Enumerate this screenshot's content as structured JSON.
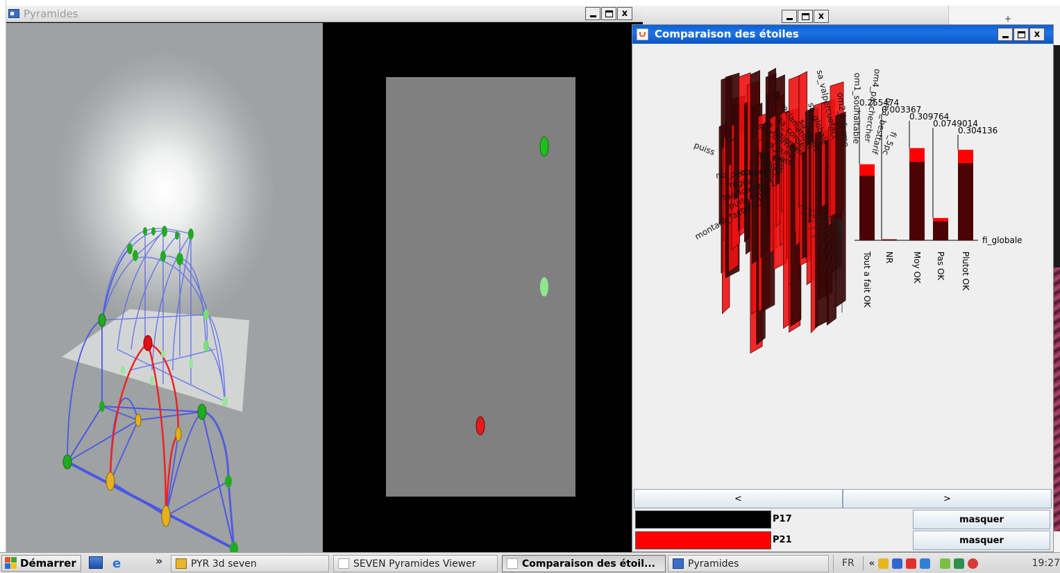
{
  "pyramides_window": {
    "title": "Pyramides",
    "controls": {
      "minimize": "_",
      "maximize": "□",
      "close": "x"
    }
  },
  "background_window": {
    "controls": {
      "minimize": "_",
      "maximize": "□",
      "close": "x"
    }
  },
  "far_right_marks": "+",
  "comparaison_window": {
    "title": "Comparaison des étoiles",
    "controls": {
      "minimize": "_",
      "maximize": "□",
      "close": "x"
    },
    "nav": {
      "prev_label": "<",
      "next_label": ">"
    },
    "legend": [
      {
        "label": "P17",
        "color": "#000000",
        "button": "masquer"
      },
      {
        "label": "P21",
        "color": "#ff0000",
        "button": "masquer"
      }
    ]
  },
  "chart_data": {
    "type": "bar",
    "star_axes": [
      "montant_facture_HT",
      "puissance",
      "tarification",
      "naf_1",
      "region_site",
      "nb_personnes",
      "contactEDF",
      "image",
      "sa_tel",
      "sa_visite",
      "sa_suivi",
      "sa_courrier",
      "sa_paiement",
      "sa_conseil",
      "sa_reclamation",
      "sa_tarifs",
      "sa_globale",
      "sa_valpercuefact",
      "om2_informe",
      "om1_souhaitable",
      "om4_paschercher",
      "om3_besttarif",
      "fi_5pc"
    ],
    "partial_axis_labels": [
      "puiss",
      "ay"
    ],
    "bar_axis_label": "fi_globale",
    "categories": [
      "Tout a fait OK",
      "NR",
      "Moy OK",
      "Pas OK",
      "Plutot OK"
    ],
    "value_labels": [
      "0.255474",
      "0.003367",
      "0.309764",
      "0.0749014",
      "0.304136"
    ],
    "series": [
      {
        "name": "P17",
        "color": "#000000",
        "values": [
          0.255474,
          0.003367,
          0.309764,
          0.0749014,
          0.304136
        ]
      },
      {
        "name": "P21",
        "color": "#ff0000",
        "values": [
          0.255474,
          0.003367,
          0.309764,
          0.0749014,
          0.304136
        ]
      }
    ]
  },
  "taskbar": {
    "start_label": "Démarrer",
    "overflow_chevron": "»",
    "buttons": [
      {
        "label": "PYR 3d seven",
        "active": false
      },
      {
        "label": "SEVEN Pyramides Viewer",
        "active": false
      },
      {
        "label": "Comparaison des étoil...",
        "active": true
      },
      {
        "label": "Pyramides",
        "active": false
      }
    ],
    "tray": {
      "language": "FR",
      "expand": "«",
      "time": "19:27"
    }
  }
}
